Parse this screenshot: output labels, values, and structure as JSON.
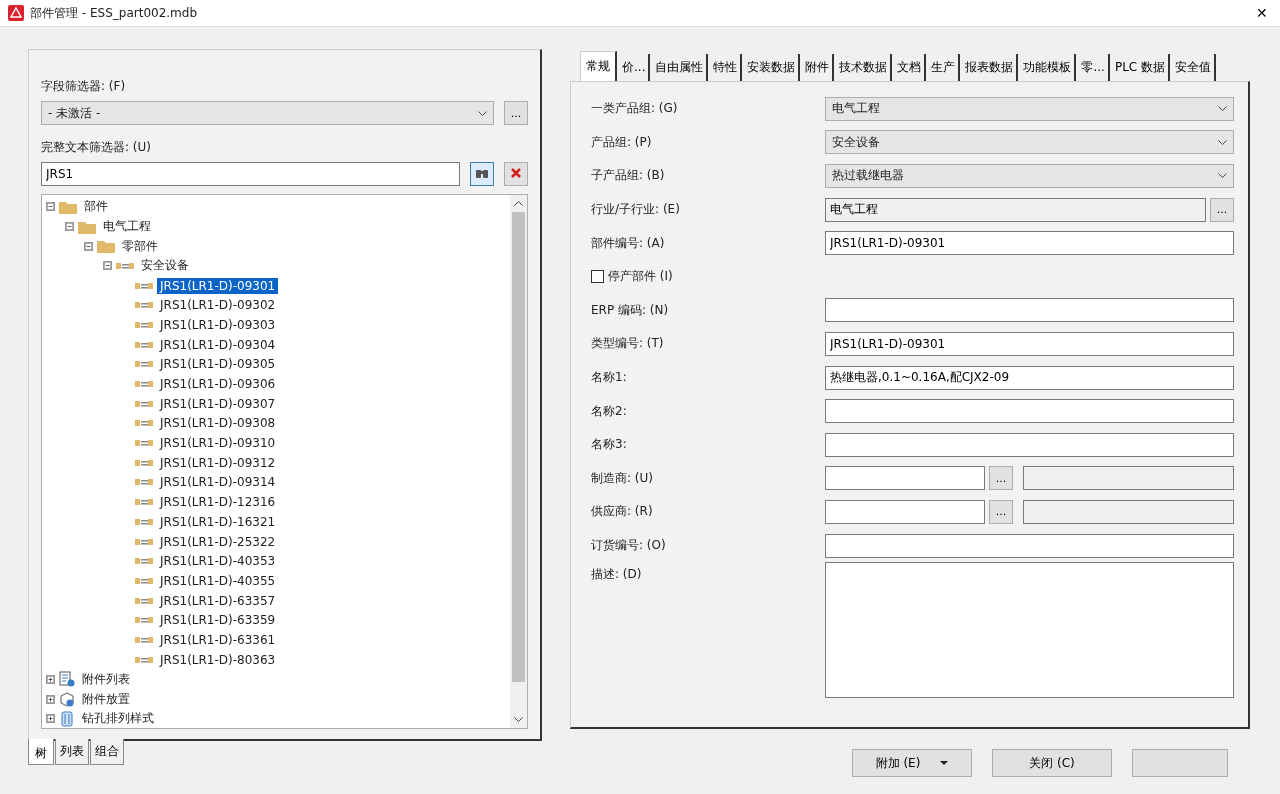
{
  "window": {
    "title": "部件管理 - ESS_part002.mdb",
    "close": "✕"
  },
  "left": {
    "field_filter": {
      "label": "字段筛选器: (F)",
      "value": "- 未激活 -",
      "button": "..."
    },
    "text_filter": {
      "label": "完整文本筛选器: (U)",
      "value": "JRS1"
    },
    "tree": [
      {
        "label": "部件",
        "kind": "folder",
        "expanded": true,
        "selected": false,
        "children": [
          {
            "label": "电气工程",
            "kind": "folder",
            "expanded": true,
            "selected": false,
            "children": [
              {
                "label": "零部件",
                "kind": "folder",
                "expanded": true,
                "selected": false,
                "children": [
                  {
                    "label": "安全设备",
                    "kind": "part",
                    "expanded": true,
                    "selected": false,
                    "children": [
                      {
                        "label": "JRS1(LR1-D)-09301",
                        "kind": "part",
                        "selected": true
                      },
                      {
                        "label": "JRS1(LR1-D)-09302",
                        "kind": "part",
                        "selected": false
                      },
                      {
                        "label": "JRS1(LR1-D)-09303",
                        "kind": "part",
                        "selected": false
                      },
                      {
                        "label": "JRS1(LR1-D)-09304",
                        "kind": "part",
                        "selected": false
                      },
                      {
                        "label": "JRS1(LR1-D)-09305",
                        "kind": "part",
                        "selected": false
                      },
                      {
                        "label": "JRS1(LR1-D)-09306",
                        "kind": "part",
                        "selected": false
                      },
                      {
                        "label": "JRS1(LR1-D)-09307",
                        "kind": "part",
                        "selected": false
                      },
                      {
                        "label": "JRS1(LR1-D)-09308",
                        "kind": "part",
                        "selected": false
                      },
                      {
                        "label": "JRS1(LR1-D)-09310",
                        "kind": "part",
                        "selected": false
                      },
                      {
                        "label": "JRS1(LR1-D)-09312",
                        "kind": "part",
                        "selected": false
                      },
                      {
                        "label": "JRS1(LR1-D)-09314",
                        "kind": "part",
                        "selected": false
                      },
                      {
                        "label": "JRS1(LR1-D)-12316",
                        "kind": "part",
                        "selected": false
                      },
                      {
                        "label": "JRS1(LR1-D)-16321",
                        "kind": "part",
                        "selected": false
                      },
                      {
                        "label": "JRS1(LR1-D)-25322",
                        "kind": "part",
                        "selected": false
                      },
                      {
                        "label": "JRS1(LR1-D)-40353",
                        "kind": "part",
                        "selected": false
                      },
                      {
                        "label": "JRS1(LR1-D)-40355",
                        "kind": "part",
                        "selected": false
                      },
                      {
                        "label": "JRS1(LR1-D)-63357",
                        "kind": "part",
                        "selected": false
                      },
                      {
                        "label": "JRS1(LR1-D)-63359",
                        "kind": "part",
                        "selected": false
                      },
                      {
                        "label": "JRS1(LR1-D)-63361",
                        "kind": "part",
                        "selected": false
                      },
                      {
                        "label": "JRS1(LR1-D)-80363",
                        "kind": "part",
                        "selected": false
                      }
                    ]
                  }
                ]
              }
            ]
          }
        ]
      },
      {
        "label": "附件列表",
        "kind": "list",
        "expanded": false,
        "selected": false
      },
      {
        "label": "附件放置",
        "kind": "placement",
        "expanded": false,
        "selected": false
      },
      {
        "label": "钻孔排列样式",
        "kind": "drill",
        "expanded": false,
        "selected": false
      }
    ],
    "tabs": [
      {
        "label": "树",
        "selected": true
      },
      {
        "label": "列表",
        "selected": false
      },
      {
        "label": "组合",
        "selected": false
      }
    ]
  },
  "right": {
    "tabs": [
      {
        "label": "常规",
        "selected": true
      },
      {
        "label": "价...",
        "selected": false
      },
      {
        "label": "自由属性",
        "selected": false
      },
      {
        "label": "特性",
        "selected": false
      },
      {
        "label": "安装数据",
        "selected": false
      },
      {
        "label": "附件",
        "selected": false
      },
      {
        "label": "技术数据",
        "selected": false
      },
      {
        "label": "文档",
        "selected": false
      },
      {
        "label": "生产",
        "selected": false
      },
      {
        "label": "报表数据",
        "selected": false
      },
      {
        "label": "功能模板",
        "selected": false
      },
      {
        "label": "零...",
        "selected": false
      },
      {
        "label": "PLC 数据",
        "selected": false
      },
      {
        "label": "安全值",
        "selected": false
      }
    ],
    "fields": [
      {
        "kind": "select",
        "label": "一类产品组: (G)",
        "value": "电气工程"
      },
      {
        "kind": "select",
        "label": "产品组: (P)",
        "value": "安全设备"
      },
      {
        "kind": "select",
        "label": "子产品组: (B)",
        "value": "热过载继电器"
      },
      {
        "kind": "browse",
        "label": "行业/子行业: (E)",
        "value": "电气工程",
        "button": "..."
      },
      {
        "kind": "text",
        "label": "部件编号: (A)",
        "value": "JRS1(LR1-D)-09301"
      },
      {
        "kind": "checkbox",
        "label": "停产部件 (I)",
        "checked": false
      },
      {
        "kind": "text",
        "label": "ERP 编码: (N)"
      },
      {
        "kind": "text",
        "label": "类型编号: (T)",
        "value": "JRS1(LR1-D)-09301"
      },
      {
        "kind": "text",
        "label": "名称1:",
        "value": "热继电器,0.1~0.16A,配CJX2-09"
      },
      {
        "kind": "text",
        "label": "名称2:"
      },
      {
        "kind": "text",
        "label": "名称3:"
      },
      {
        "kind": "pair",
        "label": "制造商: (U)",
        "button": "..."
      },
      {
        "kind": "pair",
        "label": "供应商: (R)",
        "button": "..."
      },
      {
        "kind": "text",
        "label": "订货编号: (O)"
      },
      {
        "kind": "textarea",
        "label": "描述: (D)"
      }
    ]
  },
  "buttons": [
    {
      "label": "附加 (E)",
      "kind": "split"
    },
    {
      "label": "关闭 (C)",
      "kind": "plain"
    },
    {
      "kind": "blank"
    }
  ]
}
